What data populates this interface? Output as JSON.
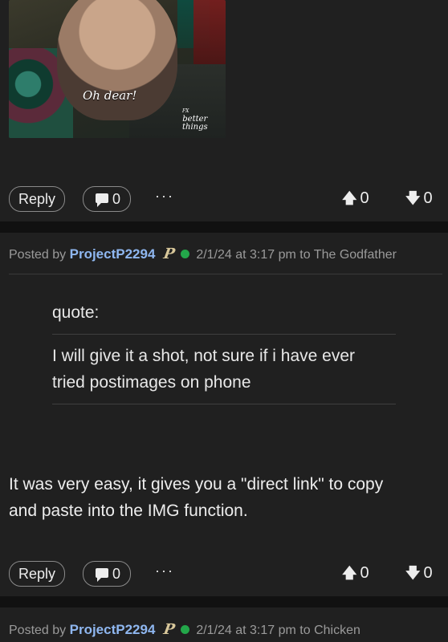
{
  "gif": {
    "caption": "Oh dear!",
    "brand_small": "FX",
    "brand_line1": "better",
    "brand_line2": "things"
  },
  "post1": {
    "actions": {
      "reply_label": "Reply",
      "comment_count": "0",
      "more_label": "···",
      "upvotes": "0",
      "downvotes": "0"
    }
  },
  "post2": {
    "posted_by": "Posted by",
    "author": "ProjectP2294",
    "badge": "P",
    "timestamp": "2/1/24 at 3:17 pm",
    "board_prefix": "to",
    "board": "The Godfather",
    "quote_label": "quote:",
    "quote_text_line1": "I will give it a shot, not sure if i have ever",
    "quote_text_line2": "tried postimages on phone",
    "body_line1": "It was very easy, it gives you a \"direct link\" to copy",
    "body_line2": "and paste into the IMG function.",
    "actions": {
      "reply_label": "Reply",
      "comment_count": "0",
      "more_label": "···",
      "upvotes": "0",
      "downvotes": "0"
    }
  },
  "post3": {
    "posted_by": "Posted by",
    "author": "ProjectP2294",
    "badge": "P",
    "timestamp": "2/1/24 at 3:17 pm",
    "board_prefix": "to",
    "board": "Chicken"
  },
  "colors": {
    "background": "#202020",
    "author_link": "#8fb7f0",
    "online_dot": "#23a74a",
    "badge_gold": "#d8c79a"
  },
  "icons": {
    "comment": "comment-bubble-icon",
    "upvote": "arrow-up-icon",
    "downvote": "arrow-down-icon",
    "more": "more-dots-icon",
    "online": "online-status-icon",
    "badge": "team-badge-icon"
  }
}
